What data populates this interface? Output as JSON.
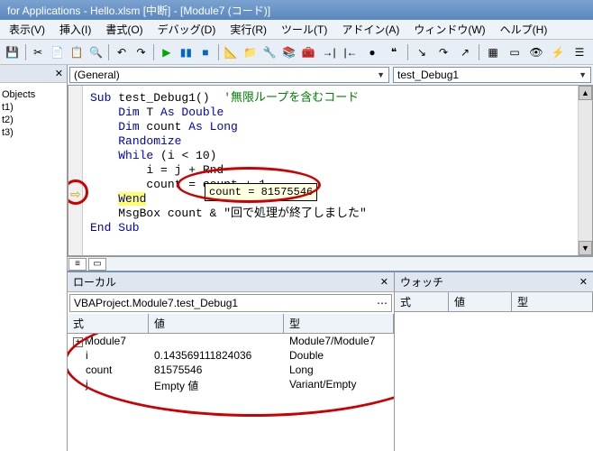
{
  "titlebar": "for Applications - Hello.xlsm [中断] - [Module7 (コード)]",
  "menu": {
    "view": "表示(V)",
    "insert": "挿入(I)",
    "format": "書式(O)",
    "debug": "デバッグ(D)",
    "run": "実行(R)",
    "tools": "ツール(T)",
    "addins": "アドイン(A)",
    "window": "ウィンドウ(W)",
    "help": "ヘルプ(H)"
  },
  "dropdowns": {
    "general": "(General)",
    "proc": "test_Debug1"
  },
  "code": {
    "l1_sub": "Sub",
    "l1_name": " test_Debug1()  ",
    "l1_cm": "'無限ループを含むコード",
    "l2_dim": "Dim",
    "l2_rest": " T ",
    "l2_as": "As Double",
    "l3_dim": "Dim",
    "l3_rest": " count ",
    "l3_as": "As Long",
    "l4": "Randomize",
    "l5_while": "While",
    "l5_rest": " (i < 10)",
    "l6": "i = j + Rnd",
    "l7": "count = count + 1",
    "l8": "Wend",
    "l9_a": "MsgBox",
    "l9_b": " count & \"回で処理が終了しました\"",
    "l10": "End Sub"
  },
  "tooltip": "count = 81575546",
  "tree": {
    "objects": "Objects",
    "t1": "t1)",
    "t2": "t2)",
    "t3": "t3)"
  },
  "locals": {
    "title": "ローカル",
    "context": "VBAProject.Module7.test_Debug1",
    "headers": {
      "expr": "式",
      "val": "値",
      "type": "型"
    },
    "rows": [
      {
        "expr": "Module7",
        "val": "",
        "type": "Module7/Module7",
        "expand": true
      },
      {
        "expr": "i",
        "val": "0.143569111824036",
        "type": "Double"
      },
      {
        "expr": "count",
        "val": "81575546",
        "type": "Long"
      },
      {
        "expr": "j",
        "val": "Empty 値",
        "type": "Variant/Empty"
      }
    ]
  },
  "watch": {
    "title": "ウォッチ",
    "headers": {
      "expr": "式",
      "val": "値",
      "type": "型"
    }
  },
  "icons": {
    "close": "✕",
    "dropdown": "▼",
    "up": "▲",
    "dn": "▼",
    "play": "▶",
    "pause": "▮▮",
    "stop": "■",
    "dots": "⋯",
    "plus": "+"
  }
}
